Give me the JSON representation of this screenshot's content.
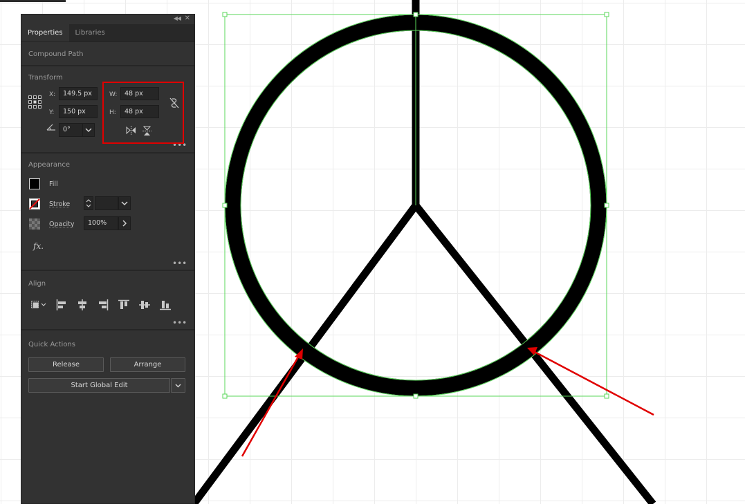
{
  "panel": {
    "tabs": [
      {
        "label": "Properties",
        "active": true
      },
      {
        "label": "Libraries",
        "active": false
      }
    ],
    "object_type": "Compound Path",
    "transform": {
      "title": "Transform",
      "x_label": "X:",
      "x_value": "149.5 px",
      "y_label": "Y:",
      "y_value": "150 px",
      "w_label": "W:",
      "w_value": "48 px",
      "h_label": "H:",
      "h_value": "48 px",
      "angle_value": "0°"
    },
    "appearance": {
      "title": "Appearance",
      "fill_label": "Fill",
      "stroke_label": "Stroke",
      "opacity_label": "Opacity",
      "opacity_value": "100%",
      "fx_label": "fx."
    },
    "align": {
      "title": "Align"
    },
    "quick_actions": {
      "title": "Quick Actions",
      "release_label": "Release",
      "arrange_label": "Arrange",
      "global_edit_label": "Start Global Edit"
    }
  },
  "colors": {
    "panel_bg": "#323232",
    "selection": "#5ad75a",
    "annotation": "#e00000",
    "artwork": "#000000"
  },
  "icons": {
    "collapse": "double-chevron-left-icon",
    "close": "close-icon",
    "constrain": "unlink-proportions-icon",
    "flip_h": "flip-horizontal-icon",
    "flip_v": "flip-vertical-icon",
    "more": "more-options-icon"
  }
}
